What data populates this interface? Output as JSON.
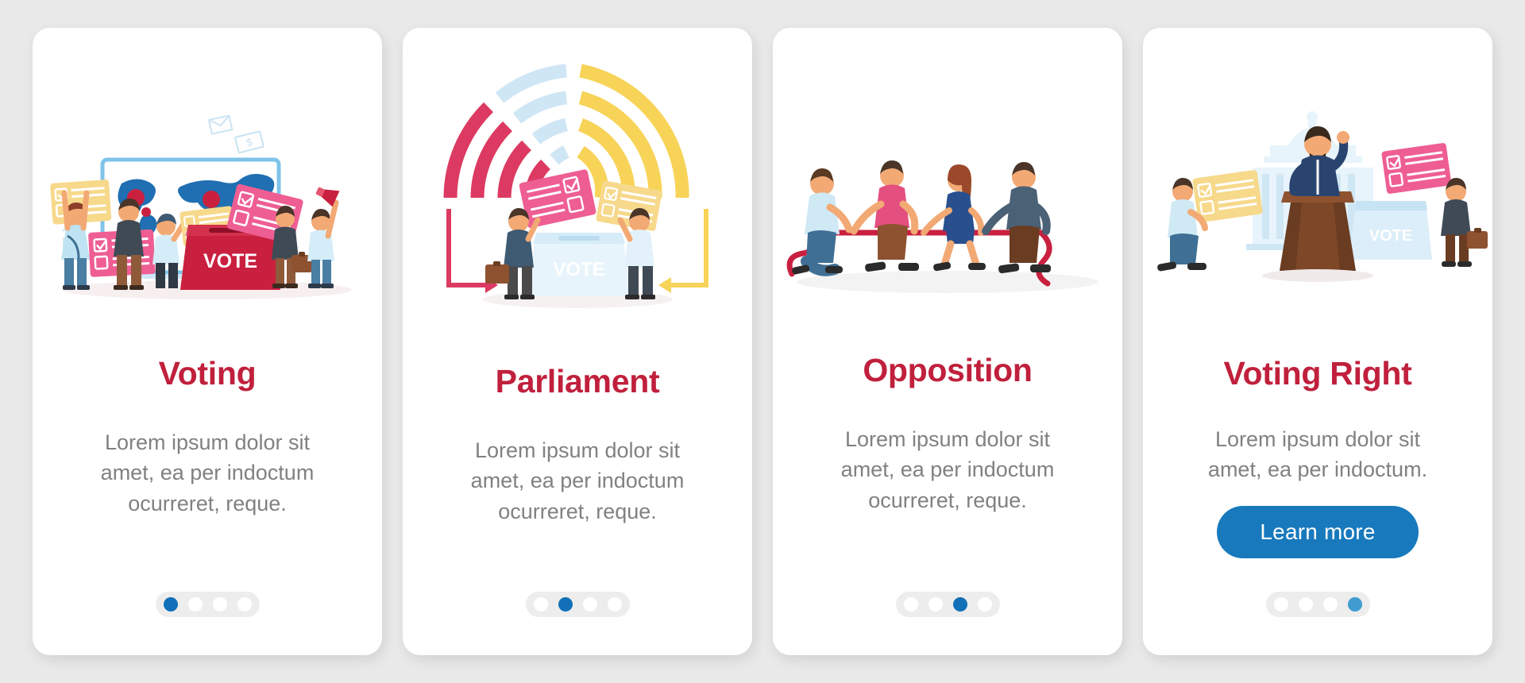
{
  "background_color": "#e9e9e9",
  "theme": {
    "title_color": "#c0203c",
    "body_color": "#818181",
    "card_background": "#ffffff",
    "accent_blue": "#1879bd",
    "dot_track": "#ededed",
    "dot_inactive": "#ffffff",
    "dot_active": "#1270b8",
    "dot_active_light": "#3f9bd0",
    "illustration_red": "#d8385e",
    "illustration_crimson": "#c9203f",
    "illustration_yellow": "#f7d358",
    "illustration_lightblue": "#cfe6f5",
    "illustration_blue": "#1f6fb2",
    "illustration_pink": "#ee5e93"
  },
  "screens": [
    {
      "id": "voting",
      "illustration": "world-map-ballot-box",
      "illustration_label": "VOTE",
      "title": "Voting",
      "body": "Lorem ipsum dolor sit amet, ea per indoctum ocurreret, reque.",
      "has_cta": false,
      "cta_label": "",
      "dots": {
        "count": 4,
        "active_index": 0,
        "active_style": "dark"
      }
    },
    {
      "id": "parliament",
      "illustration": "parliament-arc-chart-ballot-box",
      "illustration_label": "VOTE",
      "title": "Parliament",
      "body": "Lorem ipsum dolor sit amet, ea per indoctum ocurreret, reque.",
      "has_cta": false,
      "cta_label": "",
      "dots": {
        "count": 4,
        "active_index": 1,
        "active_style": "dark"
      }
    },
    {
      "id": "opposition",
      "illustration": "tug-of-war-rope",
      "illustration_label": "",
      "title": "Opposition",
      "body": "Lorem ipsum dolor sit amet, ea per indoctum ocurreret, reque.",
      "has_cta": false,
      "cta_label": "",
      "dots": {
        "count": 4,
        "active_index": 2,
        "active_style": "dark"
      }
    },
    {
      "id": "voting-right",
      "illustration": "capitol-podium-speaker",
      "illustration_label": "VOTE",
      "title": "Voting Right",
      "body": "Lorem ipsum dolor sit amet, ea per indoctum.",
      "has_cta": true,
      "cta_label": "Learn more",
      "dots": {
        "count": 4,
        "active_index": 3,
        "active_style": "light"
      }
    }
  ]
}
